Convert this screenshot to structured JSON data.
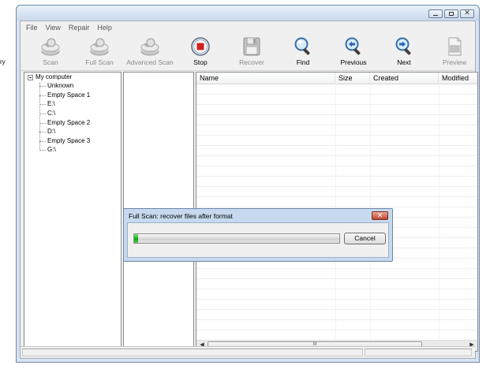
{
  "background": {
    "clipped_text": "ry"
  },
  "window": {
    "caption_buttons": {
      "minimize": "–",
      "close": "✕"
    }
  },
  "menu": [
    "File",
    "View",
    "Repair",
    "Help"
  ],
  "toolbar": [
    {
      "label": "Scan",
      "icon": "disk-scan-icon",
      "enabled": false
    },
    {
      "label": "Full Scan",
      "icon": "disk-full-scan-icon",
      "enabled": false
    },
    {
      "label": "Advanced Scan",
      "icon": "disk-advanced-scan-icon",
      "enabled": false
    },
    {
      "label": "Stop",
      "icon": "stop-icon",
      "enabled": true
    },
    {
      "label": "Recover",
      "icon": "floppy-save-icon",
      "enabled": false
    },
    {
      "label": "Find",
      "icon": "magnifier-icon",
      "enabled": true
    },
    {
      "label": "Previous",
      "icon": "magnifier-left-arrow-icon",
      "enabled": true
    },
    {
      "label": "Next",
      "icon": "magnifier-right-arrow-icon",
      "enabled": true
    },
    {
      "label": "Preview",
      "icon": "preview-document-icon",
      "enabled": false
    }
  ],
  "tree": {
    "root": "My computer",
    "children": [
      "Unknown",
      "Empty Space 1",
      "E:\\",
      "C:\\",
      "Empty Space 2",
      "D:\\",
      "Empty Space 3",
      "G:\\"
    ]
  },
  "list": {
    "columns": [
      "Name",
      "Size",
      "Created",
      "Modified"
    ],
    "scroll_thumb_grip": "III"
  },
  "dialog": {
    "title": "Full Scan: recover files after format",
    "close_glyph": "✕",
    "progress": 0.015,
    "cancel_label": "Cancel"
  },
  "colors": {
    "progress_green": "#18b818",
    "stop_red": "#d42020",
    "window_frame": "#d6e3f2"
  }
}
